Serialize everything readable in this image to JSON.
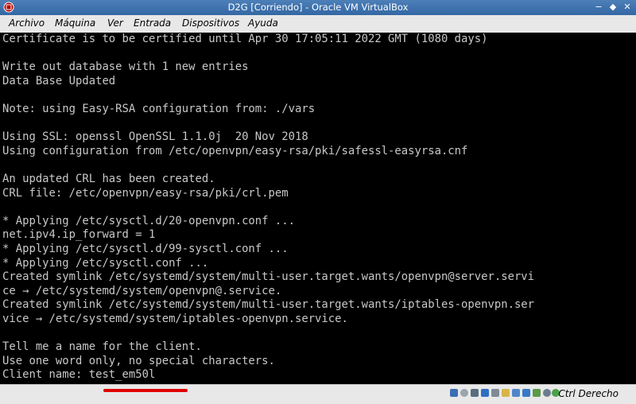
{
  "window": {
    "title": "D2G [Corriendo] - Oracle VM VirtualBox"
  },
  "menu": [
    "Archivo",
    "Máquina",
    "Ver",
    "Entrada",
    "Dispositivos",
    "Ayuda"
  ],
  "terminal_lines": [
    "Certificate is to be certified until Apr 30 17:05:11 2022 GMT (1080 days)",
    "",
    "Write out database with 1 new entries",
    "Data Base Updated",
    "",
    "Note: using Easy-RSA configuration from: ./vars",
    "",
    "Using SSL: openssl OpenSSL 1.1.0j  20 Nov 2018",
    "Using configuration from /etc/openvpn/easy-rsa/pki/safessl-easyrsa.cnf",
    "",
    "An updated CRL has been created.",
    "CRL file: /etc/openvpn/easy-rsa/pki/crl.pem",
    "",
    "* Applying /etc/sysctl.d/20-openvpn.conf ...",
    "net.ipv4.ip_forward = 1",
    "* Applying /etc/sysctl.d/99-sysctl.conf ...",
    "* Applying /etc/sysctl.conf ...",
    "Created symlink /etc/systemd/system/multi-user.target.wants/openvpn@server.servi",
    "ce → /etc/systemd/system/openvpn@.service.",
    "Created symlink /etc/systemd/system/multi-user.target.wants/iptables-openvpn.ser",
    "vice → /etc/systemd/system/iptables-openvpn.service.",
    "",
    "Tell me a name for the client.",
    "Use one word only, no special characters.",
    "Client name: test_em50l"
  ],
  "statusbar": {
    "host_key": "Ctrl Derecho",
    "icons": [
      "hard-disk-icon",
      "optical-drive-icon",
      "audio-icon",
      "network-icon",
      "usb-icon",
      "shared-folders-icon",
      "display-icon",
      "video-capture-icon",
      "cpu-icon",
      "mouse-integration-icon",
      "keyboard-icon"
    ]
  },
  "colors": {
    "titlebar": "#3d72b0",
    "terminal_text": "#c8c8c8",
    "highlight": "#e00000"
  }
}
